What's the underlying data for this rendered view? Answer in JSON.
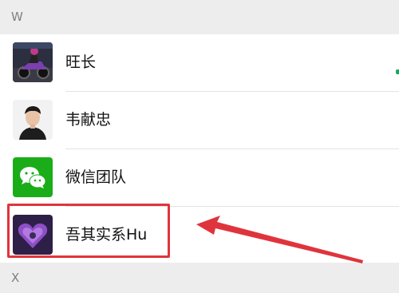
{
  "sections": [
    {
      "letter": "W"
    },
    {
      "letter": "X"
    }
  ],
  "contacts": [
    {
      "name": "旺长",
      "avatar_icon": "motorcycle-photo"
    },
    {
      "name": "韦献忠",
      "avatar_icon": "person-portrait"
    },
    {
      "name": "微信团队",
      "avatar_icon": "wechat-logo",
      "avatar_color": "#1aad19"
    },
    {
      "name": "吾其实系Hu",
      "avatar_icon": "purple-heart-photo"
    }
  ],
  "annotation": {
    "highlight_color": "#e0343c",
    "arrow_color": "#e0343c"
  }
}
